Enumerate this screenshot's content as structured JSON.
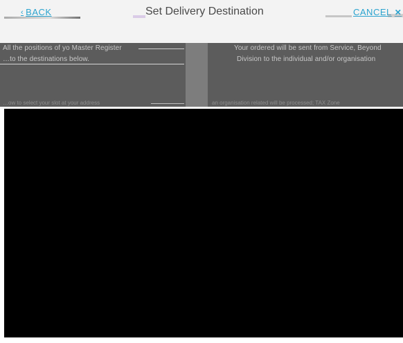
{
  "header": {
    "back_label": "BACK",
    "title": "Set Delivery Destination",
    "cancel_label": "CANCEL"
  },
  "left_panel": {
    "line1": "All the positions of yo Master Register",
    "line2": "…to the destinations below.",
    "footer": "…ow to select your slot at your address"
  },
  "right_panel": {
    "line1": "Your ordered will be sent from Service, Beyond",
    "line2": "Division to the individual and/or organisation",
    "footer": "an organisation related will be processed; TAX Zone"
  },
  "colors": {
    "accent": "#2aa3cf",
    "header_bg": "#f3f3f3",
    "panel_bg": "#5c5c5c",
    "divider": "#7d7d7d"
  },
  "icons": {
    "back": "chevron-left-icon",
    "cancel": "close-icon"
  }
}
